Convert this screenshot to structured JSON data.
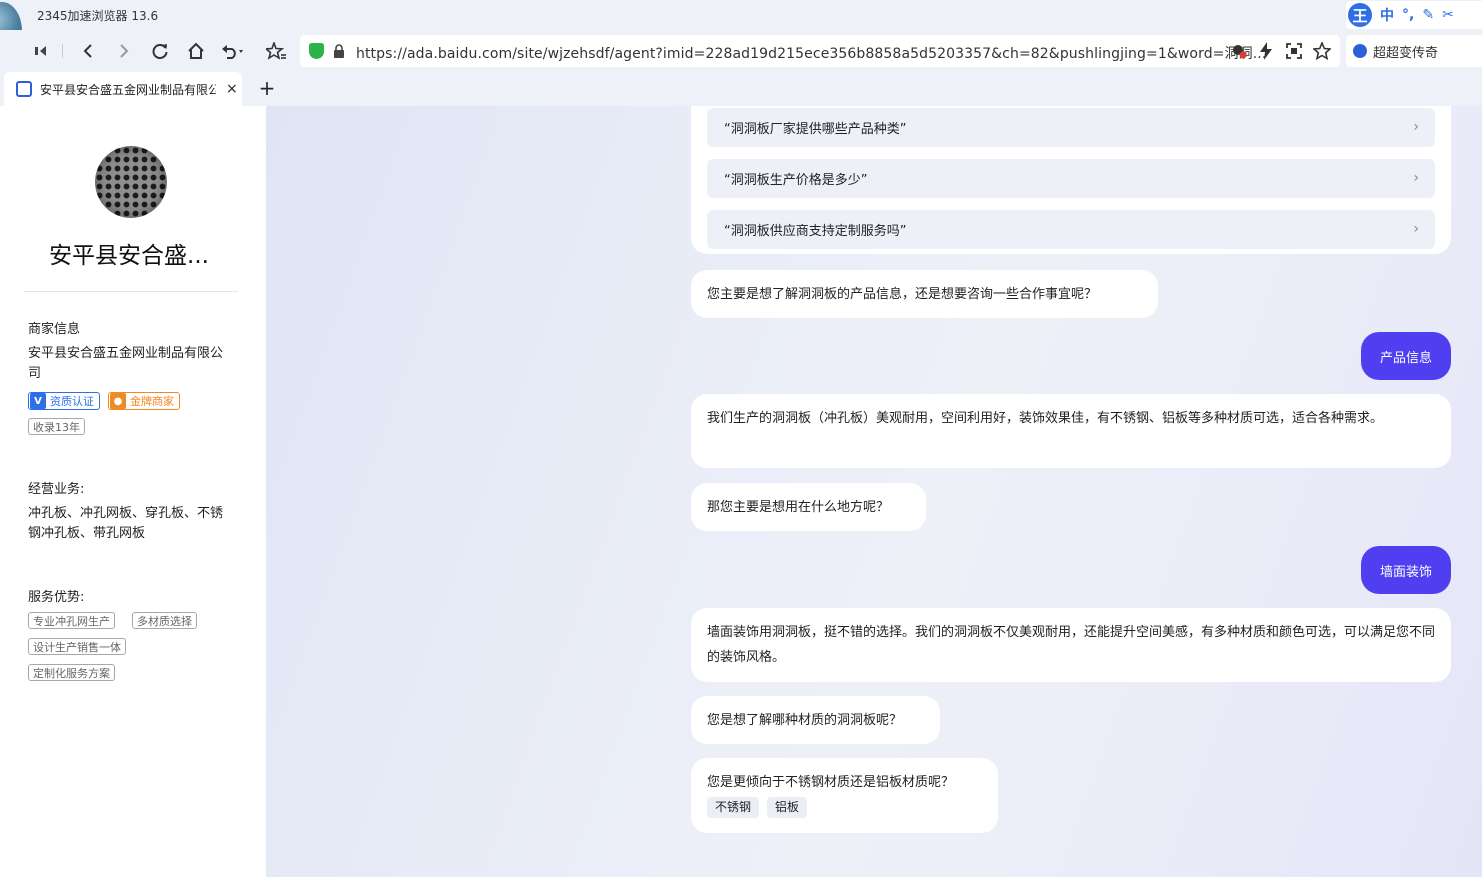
{
  "browser": {
    "app_title": "2345加速浏览器 13.6",
    "url": "https://ada.baidu.com/site/wjzehsdf/agent?imid=228ad19d215ece356b8858a5d5203357&ch=82&pushlingjing=1&word=洞洞...",
    "search_text": "超超变传奇",
    "ime": {
      "logo": "王",
      "mode": "中",
      "punct": "°,",
      "pen": "✎",
      "tools": "✂"
    },
    "tab": {
      "title": "安平县安合盛五金网业制品有限公司",
      "close": "×"
    },
    "new_tab": "+"
  },
  "sidebar": {
    "name": "安平县安合盛...",
    "merchant_info_title": "商家信息",
    "company": "安平县安合盛五金网业制品有限公司",
    "badges": [
      {
        "icon": "V",
        "label": "资质认证"
      },
      {
        "icon": "●",
        "label": "金牌商家"
      }
    ],
    "record_years": "收录13年",
    "business_title": "经营业务:",
    "business_text": "冲孔板、冲孔网板、穿孔板、不锈钢冲孔板、带孔网板",
    "advantages_title": "服务优势:",
    "advantages": [
      "专业冲孔网生产",
      "多材质选择",
      "设计生产销售一体",
      "定制化服务方案"
    ]
  },
  "chat": {
    "suggestions": [
      "“洞洞板厂家提供哪些产品种类”",
      "“洞洞板生产价格是多少”",
      "“洞洞板供应商支持定制服务吗”"
    ],
    "messages": [
      {
        "role": "bot",
        "text": "您主要是想了解洞洞板的产品信息，还是想要咨询一些合作事宜呢？"
      },
      {
        "role": "user",
        "text": "产品信息"
      },
      {
        "role": "bot",
        "text": "我们生产的洞洞板（冲孔板）美观耐用，空间利用好，装饰效果佳，有不锈钢、铝板等多种材质可选，适合各种需求。"
      },
      {
        "role": "bot",
        "text": "那您主要是想用在什么地方呢？"
      },
      {
        "role": "user",
        "text": "墙面装饰"
      },
      {
        "role": "bot",
        "text": "墙面装饰用洞洞板，挺不错的选择。我们的洞洞板不仅美观耐用，还能提升空间美感，有多种材质和颜色可选，可以满足您不同的装饰风格。"
      },
      {
        "role": "bot",
        "text": "您是想了解哪种材质的洞洞板呢？"
      },
      {
        "role": "bot",
        "text": "您是更倾向于不锈钢材质还是铝板材质呢？",
        "options": [
          "不锈钢",
          "铝板"
        ]
      }
    ]
  },
  "colors": {
    "user_bubble": "#4f3ff0",
    "badge_blue": "#2e6fe6",
    "badge_gold": "#f08a24",
    "secure_green": "#2cb34a"
  }
}
